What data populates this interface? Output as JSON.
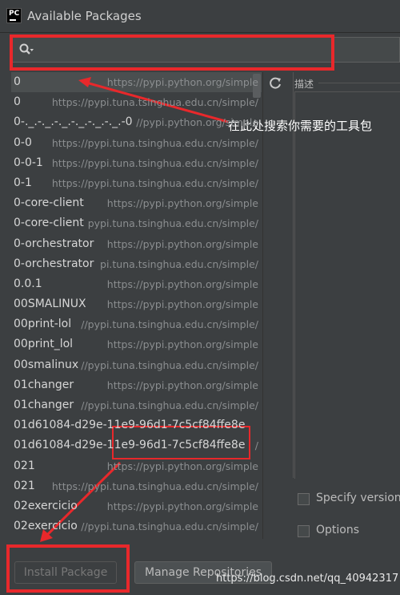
{
  "window": {
    "title": "Available Packages",
    "app_icon": "PC"
  },
  "search": {
    "value": "",
    "placeholder": "",
    "icon": "search-icon"
  },
  "packages": [
    {
      "name": "0",
      "repo": "https://pypi.python.org/simple",
      "selected": true
    },
    {
      "name": "0",
      "repo": "https://pypi.tuna.tsinghua.edu.cn/simple/",
      "selected": false
    },
    {
      "name": "0-._.-._.-._.-._.-._.-._.-0",
      "repo": "//pypi.python.org/simple",
      "selected": false
    },
    {
      "name": "0-0",
      "repo": "https://pypi.tuna.tsinghua.edu.cn/simple/",
      "selected": false
    },
    {
      "name": "0-0-1",
      "repo": "https://pypi.tuna.tsinghua.edu.cn/simple/",
      "selected": false
    },
    {
      "name": "0-1",
      "repo": "https://pypi.tuna.tsinghua.edu.cn/simple/",
      "selected": false
    },
    {
      "name": "0-core-client",
      "repo": "https://pypi.python.org/simple",
      "selected": false
    },
    {
      "name": "0-core-client",
      "repo": "pypi.tuna.tsinghua.edu.cn/simple/",
      "selected": false
    },
    {
      "name": "0-orchestrator",
      "repo": "https://pypi.python.org/simple",
      "selected": false
    },
    {
      "name": "0-orchestrator",
      "repo": "pi.tuna.tsinghua.edu.cn/simple/",
      "selected": false
    },
    {
      "name": "0.0.1",
      "repo": "https://pypi.python.org/simple",
      "selected": false
    },
    {
      "name": "00SMALINUX",
      "repo": "https://pypi.python.org/simple",
      "selected": false
    },
    {
      "name": "00print-lol",
      "repo": "//pypi.tuna.tsinghua.edu.cn/simple/",
      "selected": false
    },
    {
      "name": "00print_lol",
      "repo": "https://pypi.python.org/simple",
      "selected": false
    },
    {
      "name": "00smalinux",
      "repo": "//pypi.tuna.tsinghua.edu.cn/simple/",
      "selected": false
    },
    {
      "name": "01changer",
      "repo": "https://pypi.python.org/simple",
      "selected": false
    },
    {
      "name": "01changer",
      "repo": "//pypi.tuna.tsinghua.edu.cn/simple/",
      "selected": false
    },
    {
      "name": "01d61084-d29e-11e9-96d1-7c5cf84ffe8e",
      "repo": "",
      "selected": false
    },
    {
      "name": "01d61084-d29e-11e9-96d1-7c5cf84ffe8e",
      "repo": "/",
      "selected": false
    },
    {
      "name": "021",
      "repo": "https://pypi.python.org/simple",
      "selected": false
    },
    {
      "name": "021",
      "repo": "https://pypi.tuna.tsinghua.edu.cn/simple/",
      "selected": false
    },
    {
      "name": "02exercicio",
      "repo": "https://pypi.python.org/simple",
      "selected": false
    },
    {
      "name": "02exercicio",
      "repo": "//pypi.tuna.tsinghua.edu.cn/simple/",
      "selected": false
    }
  ],
  "details": {
    "description_label": "描述",
    "specify_version_label": "Specify version",
    "options_label": "Options"
  },
  "buttons": {
    "install": "Install Package",
    "manage": "Manage Repositories"
  },
  "annotation": {
    "text": "在此处搜索你需要的工具包"
  },
  "watermark": {
    "text": "https://blog.csdn.net/qq_40942317"
  },
  "colors": {
    "background": "#3c3f41",
    "highlight": "#e8282b",
    "selected_row": "#4b4f50"
  }
}
